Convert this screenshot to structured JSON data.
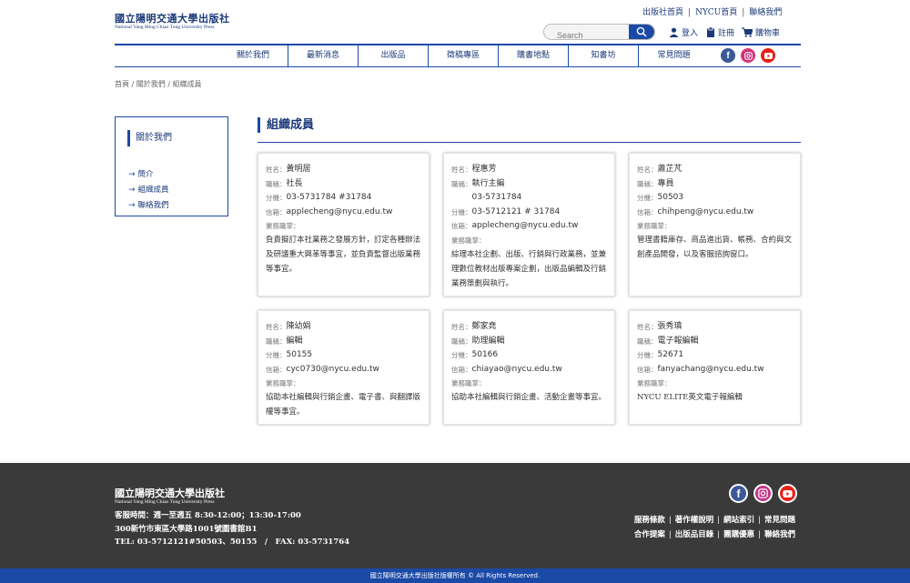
{
  "top_links": [
    "出版社首頁",
    "NYCU首頁",
    "聯絡我們"
  ],
  "logo": {
    "zh": "國立陽明交通大學出版社",
    "en": "National Yang Ming Chiao Tung University Press"
  },
  "search": {
    "placeholder": "Search"
  },
  "account": {
    "login": "登入",
    "register": "註冊",
    "cart": "購物車"
  },
  "nav": [
    "關於我們",
    "最新消息",
    "出版品",
    "徵稿專區",
    "購書地點",
    "知書坊",
    "常見問題"
  ],
  "breadcrumb": "首頁 / 關於我們 / 組織成員",
  "sidebar": {
    "title": "關於我們",
    "items": [
      "簡介",
      "組織成員",
      "聯絡我們"
    ]
  },
  "section_title": "組織成員",
  "labels": {
    "name": "姓名：",
    "title": "職稱：",
    "ext": "分機：",
    "email": "信箱：",
    "duty": "業務職掌："
  },
  "members": [
    {
      "name": "黃明居",
      "title": "社長",
      "title2": "",
      "ext": "03-5731784 #31784",
      "email": "applecheng@nycu.edu.tw",
      "duty": "負責擬訂本社業務之發展方針，訂定各種辦法及研議重大興革等事宜，並負責監督出版業務等事宜。"
    },
    {
      "name": "程惠芳",
      "title": "執行主編",
      "title2": "03-5731784",
      "ext": "03-5712121 # 31784",
      "email": "applecheng@nycu.edu.tw",
      "duty": "綜理本社企劃、出版、行銷與行政業務，並兼理數位教材出版專案企劃，出版品編輯及行銷業務策劃與執行。"
    },
    {
      "name": "蕭芷芃",
      "title": "專員",
      "title2": "",
      "ext": "50503",
      "email": "chihpeng@nycu.edu.tw",
      "duty": "管理書籍庫存、商品進出貨、帳務、合約與文創產品開發，以及客服諮詢窗口。"
    },
    {
      "name": "陳幼娟",
      "title": "編輯",
      "title2": "",
      "ext": "50155",
      "email": "cyc0730@nycu.edu.tw",
      "duty": "協助本社編輯與行銷企畫、電子書、與翻譯版權等事宜。"
    },
    {
      "name": "鄭家堯",
      "title": "助理編輯",
      "title2": "",
      "ext": "50166",
      "email": "chiayao@nycu.edu.tw",
      "duty": "協助本社編輯與行銷企畫、活動企畫等事宜。"
    },
    {
      "name": "張秀瑱",
      "title": "電子報編輯",
      "title2": "",
      "ext": "52671",
      "email": "fanyachang@nycu.edu.tw",
      "duty": "NYCU ELITE英文電子報編輯"
    }
  ],
  "footer": {
    "logo_zh": "國立陽明交通大學出版社",
    "logo_en": "National Yang Ming Chiao Tung University Press",
    "hours": "客服時間：週一至週五 8:30-12:00；13:30-17:00",
    "address": "300新竹市東區大學路1001號圖書館B1",
    "phone": "TEL: 03-5712121#50503、50155　/　FAX: 03-5731764",
    "links_row1": [
      "服務條款",
      "著作權說明",
      "網站索引",
      "常見問題"
    ],
    "links_row2": [
      "合作提案",
      "出版品目錄",
      "團購優惠",
      "聯絡我們"
    ],
    "copyright": "國立陽明交通大學出版社版權所有 © All Rights Reserved."
  },
  "colors": {
    "primary": "#1b4aa6",
    "footer_bg": "#3a3a3a"
  },
  "icons": {
    "search": "search-icon",
    "user": "user-icon",
    "register": "clipboard-icon",
    "cart": "cart-icon",
    "facebook": "facebook-icon",
    "instagram": "instagram-icon",
    "youtube": "youtube-icon"
  }
}
